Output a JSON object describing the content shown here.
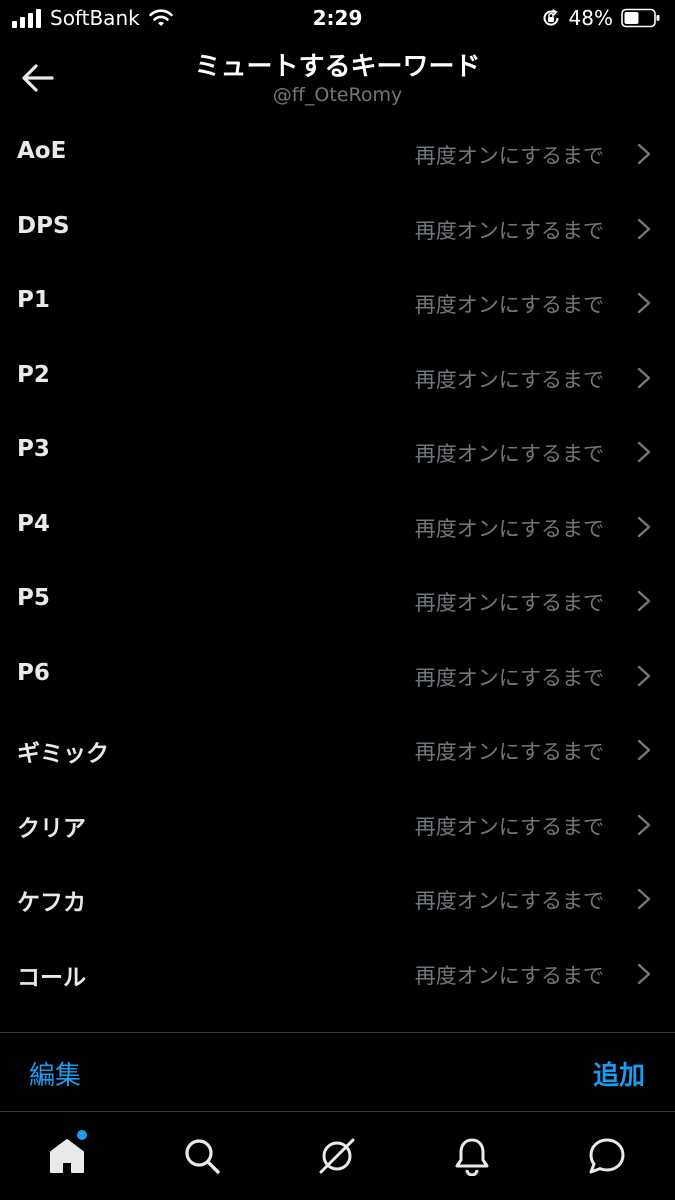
{
  "status_bar": {
    "carrier": "SoftBank",
    "time": "2:29",
    "battery_percent": "48%"
  },
  "header": {
    "title": "ミュートするキーワード",
    "subtitle": "@ff_OteRomy"
  },
  "keywords": [
    {
      "label": "AoE",
      "status": "再度オンにするまで"
    },
    {
      "label": "DPS",
      "status": "再度オンにするまで"
    },
    {
      "label": "P1",
      "status": "再度オンにするまで"
    },
    {
      "label": "P2",
      "status": "再度オンにするまで"
    },
    {
      "label": "P3",
      "status": "再度オンにするまで"
    },
    {
      "label": "P4",
      "status": "再度オンにするまで"
    },
    {
      "label": "P5",
      "status": "再度オンにするまで"
    },
    {
      "label": "P6",
      "status": "再度オンにするまで"
    },
    {
      "label": "ギミック",
      "status": "再度オンにするまで"
    },
    {
      "label": "クリア",
      "status": "再度オンにするまで"
    },
    {
      "label": "ケフカ",
      "status": "再度オンにするまで"
    },
    {
      "label": "コール",
      "status": "再度オンにするまで"
    }
  ],
  "toolbar": {
    "edit_label": "編集",
    "add_label": "追加"
  },
  "tab_bar": {
    "icons": [
      "home-icon",
      "search-icon",
      "spaces-icon",
      "notifications-icon",
      "messages-icon"
    ],
    "has_notification_dot": true
  },
  "colors": {
    "background": "#000000",
    "accent": "#1d9bf0",
    "secondary_text": "#71767b",
    "primary_text": "#e7e9ea",
    "divider": "#2f3336"
  }
}
